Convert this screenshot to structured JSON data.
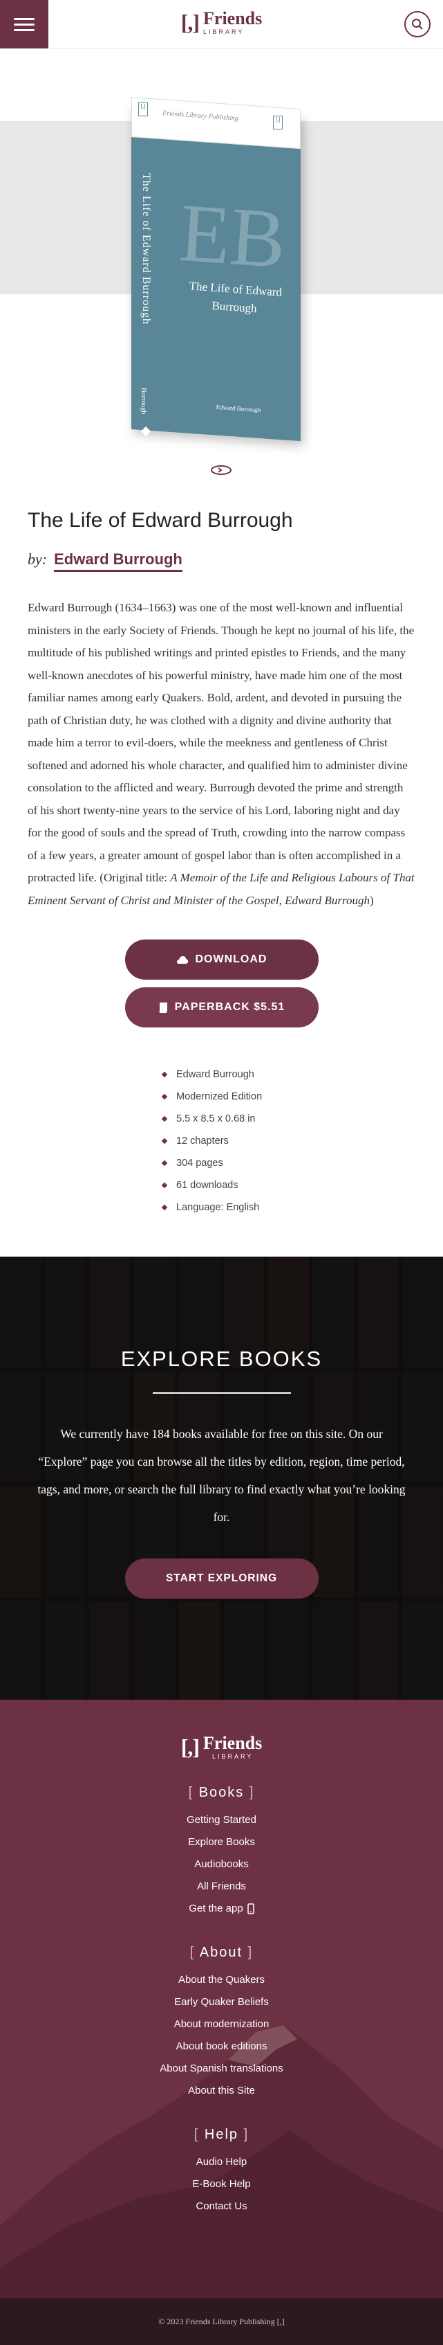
{
  "header": {
    "logo_mark": "[,]",
    "logo_name": "Friends",
    "logo_sub": "LIBRARY"
  },
  "cover": {
    "publisher": "Friends Library Publishing",
    "title_spine": "The Life of Edward Burrough",
    "title_front": "The Life of Edward Burrough",
    "author_front": "Edward Burrough",
    "author_spine": "Burrough",
    "initials": "EB"
  },
  "book": {
    "title": "The Life of Edward Burrough",
    "by_label": "by:",
    "author": "Edward Burrough",
    "description": "Edward Burrough (1634–1663) was one of the most well-known and influential ministers in the early Society of Friends. Though he kept no journal of his life, the multitude of his published writings and printed epistles to Friends, and the many well-known anecdotes of his powerful ministry, have made him one of the most familiar names among early Quakers. Bold, ardent, and devoted in pursuing the path of Christian duty, he was clothed with a dignity and divine authority that made him a terror to evil-doers, while the meekness and gentleness of Christ softened and adorned his whole character, and qualified him to administer divine consolation to the afflicted and weary. Burrough devoted the prime and strength of his short twenty-nine years to the service of his Lord, laboring night and day for the good of souls and the spread of Truth, crowding into the narrow compass of a few years, a greater amount of gospel labor than is often accomplished in a protracted life. (Original title: ",
    "original_title": "A Memoir of the Life and Religious Labours of That Eminent Servant of Christ and Minister of the Gospel, Edward Burrough",
    "desc_end": ")"
  },
  "actions": {
    "download_label": "DOWNLOAD",
    "paperback_label": "PAPERBACK $5.51"
  },
  "details": [
    "Edward Burrough",
    "Modernized Edition",
    "5.5 x 8.5 x 0.68 in",
    "12 chapters",
    "304 pages",
    "61 downloads",
    "Language: English"
  ],
  "explore": {
    "title": "EXPLORE BOOKS",
    "text": "We currently have 184 books available for free on this site. On our “Explore” page you can browse all the titles by edition, region, time period, tags, and more, or search the full library to find exactly what you’re looking for.",
    "button": "START EXPLORING"
  },
  "footer": {
    "sections": [
      {
        "title": "Books",
        "links": [
          "Getting Started",
          "Explore Books",
          "Audiobooks",
          "All Friends",
          "Get the app"
        ]
      },
      {
        "title": "About",
        "links": [
          "About the Quakers",
          "Early Quaker Beliefs",
          "About modernization",
          "About book editions",
          "About Spanish translations",
          "About this Site"
        ]
      },
      {
        "title": "Help",
        "links": [
          "Audio Help",
          "E-Book Help",
          "Contact Us"
        ]
      }
    ],
    "copyright": "© 2023 Friends Library Publishing [,]"
  },
  "colors": {
    "brand": "#6c3142",
    "cover": "#5a8798"
  }
}
